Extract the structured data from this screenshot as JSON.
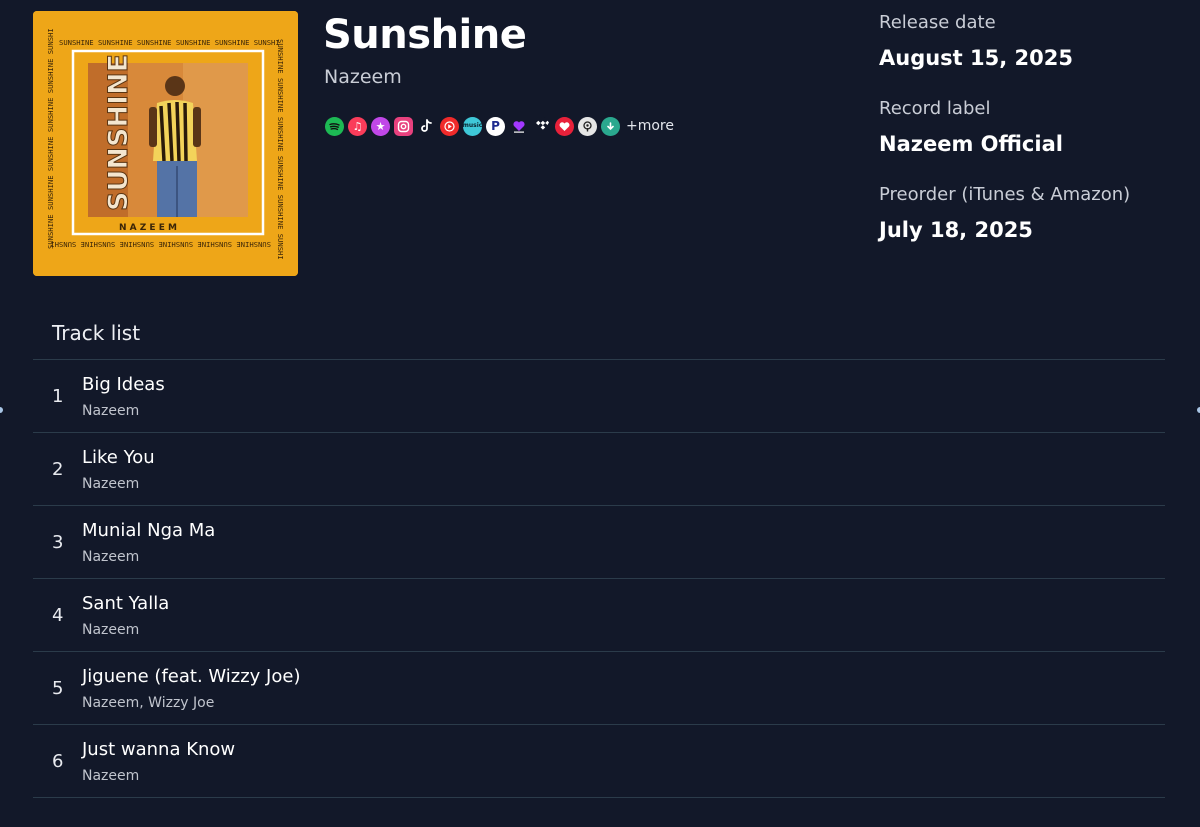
{
  "album": {
    "title": "Sunshine",
    "artist": "Nazeem",
    "cover": {
      "frame_text": "SUNSHINE SUNSHINE SUNSHINE SUNSHINE SUNSHINE SUNSHI",
      "vertical_text": "SUNSHINE",
      "artist_text": "N A Z E E M",
      "background_color": "#eea618"
    }
  },
  "platforms": [
    {
      "icon": "spotify-icon",
      "color": "#1db954"
    },
    {
      "icon": "apple-music-icon",
      "color": "#fa3c5a"
    },
    {
      "icon": "itunes-star-icon",
      "color": "#c047e8"
    },
    {
      "icon": "instagram-icon",
      "color": "#e8417e"
    },
    {
      "icon": "tiktok-icon",
      "color": "#121829"
    },
    {
      "icon": "youtube-music-icon",
      "color": "#f02a2a"
    },
    {
      "icon": "amazon-music-icon",
      "color": "#3fc8d8"
    },
    {
      "icon": "pandora-icon",
      "color": "#ffffff"
    },
    {
      "icon": "deezer-icon",
      "color": "#a238ff"
    },
    {
      "icon": "tidal-icon",
      "color": "#121829"
    },
    {
      "icon": "iheartradio-icon",
      "color": "#e8213a"
    },
    {
      "icon": "podcast-icon",
      "color": "#e6e6e6"
    },
    {
      "icon": "audiomack-icon",
      "color": "#2aa88e"
    }
  ],
  "more_label": "+more",
  "meta": {
    "release_label": "Release date",
    "release_value": "August 15, 2025",
    "record_label_label": "Record label",
    "record_label_value": "Nazeem Official",
    "preorder_label": "Preorder (iTunes & Amazon)",
    "preorder_value": "July 18, 2025"
  },
  "tracklist": {
    "title": "Track list",
    "tracks": [
      {
        "num": "1",
        "title": "Big Ideas",
        "artist": "Nazeem"
      },
      {
        "num": "2",
        "title": "Like You",
        "artist": "Nazeem"
      },
      {
        "num": "3",
        "title": "Munial Nga Ma",
        "artist": "Nazeem"
      },
      {
        "num": "4",
        "title": "Sant Yalla",
        "artist": "Nazeem"
      },
      {
        "num": "5",
        "title": "Jiguene (feat. Wizzy Joe)",
        "artist": "Nazeem, Wizzy Joe"
      },
      {
        "num": "6",
        "title": "Just wanna Know",
        "artist": "Nazeem"
      }
    ]
  }
}
